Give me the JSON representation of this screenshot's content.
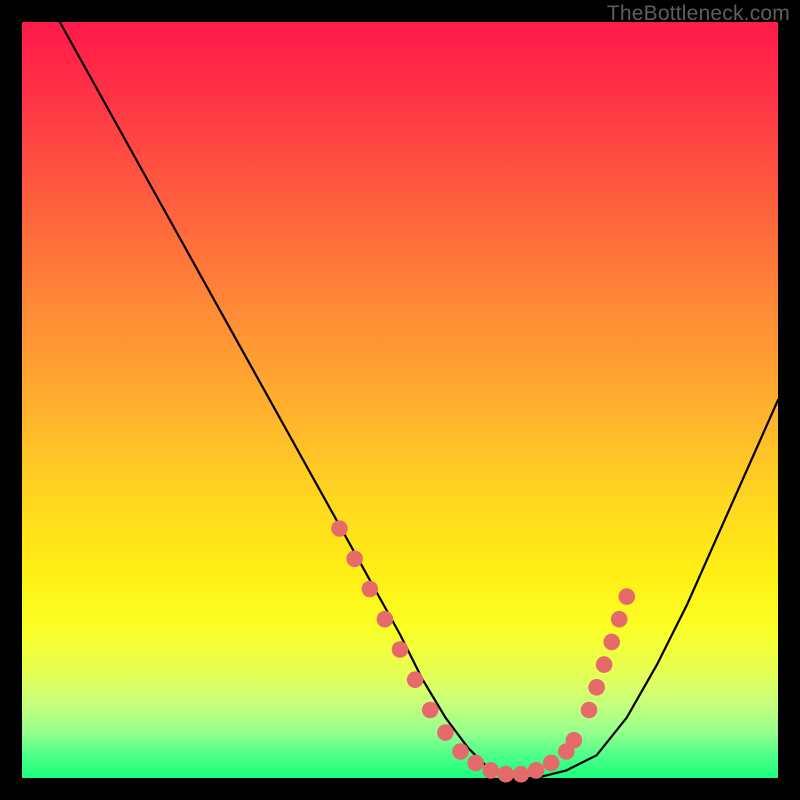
{
  "watermark": "TheBottleneck.com",
  "chart_data": {
    "type": "line",
    "title": "",
    "xlabel": "",
    "ylabel": "",
    "xlim": [
      0,
      100
    ],
    "ylim": [
      0,
      100
    ],
    "grid": false,
    "series": [
      {
        "name": "bottleneck-curve",
        "x": [
          5,
          10,
          15,
          20,
          25,
          30,
          35,
          40,
          45,
          50,
          53,
          56,
          59,
          62,
          65,
          68,
          72,
          76,
          80,
          84,
          88,
          92,
          96,
          100
        ],
        "y": [
          100,
          91,
          82,
          73,
          64,
          55,
          46,
          37,
          28,
          19,
          13,
          8,
          4,
          1,
          0,
          0,
          1,
          3,
          8,
          15,
          23,
          32,
          41,
          50
        ],
        "color": "#000000"
      }
    ],
    "markers": {
      "name": "highlight-dots",
      "color": "#e66a6a",
      "radius_pct": 1.1,
      "points": [
        {
          "x": 42,
          "y": 33
        },
        {
          "x": 44,
          "y": 29
        },
        {
          "x": 46,
          "y": 25
        },
        {
          "x": 48,
          "y": 21
        },
        {
          "x": 50,
          "y": 17
        },
        {
          "x": 52,
          "y": 13
        },
        {
          "x": 54,
          "y": 9
        },
        {
          "x": 56,
          "y": 6
        },
        {
          "x": 58,
          "y": 3.5
        },
        {
          "x": 60,
          "y": 2
        },
        {
          "x": 62,
          "y": 1
        },
        {
          "x": 64,
          "y": 0.5
        },
        {
          "x": 66,
          "y": 0.5
        },
        {
          "x": 68,
          "y": 1
        },
        {
          "x": 70,
          "y": 2
        },
        {
          "x": 72,
          "y": 3.5
        },
        {
          "x": 73,
          "y": 5
        },
        {
          "x": 75,
          "y": 9
        },
        {
          "x": 76,
          "y": 12
        },
        {
          "x": 77,
          "y": 15
        },
        {
          "x": 78,
          "y": 18
        },
        {
          "x": 79,
          "y": 21
        },
        {
          "x": 80,
          "y": 24
        }
      ]
    },
    "gradient_stops": [
      {
        "pct": 0,
        "color": "#ff1a4b"
      },
      {
        "pct": 50,
        "color": "#ffb32d"
      },
      {
        "pct": 80,
        "color": "#fbff25"
      },
      {
        "pct": 100,
        "color": "#1bff7c"
      }
    ]
  }
}
